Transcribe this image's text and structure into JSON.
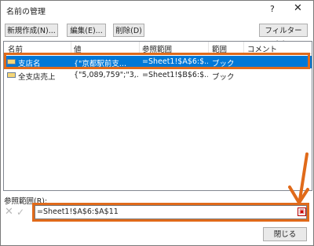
{
  "dialog": {
    "title": "名前の管理",
    "help_label": "?",
    "close_label": "✕"
  },
  "toolbar": {
    "new_label": "新規作成(N)...",
    "edit_label": "編集(E)...",
    "delete_label": "削除(D)",
    "filter_label": "フィルター(F) ▾"
  },
  "list": {
    "headers": [
      "名前",
      "値",
      "参照範囲",
      "範囲",
      "コメント"
    ],
    "rows": [
      {
        "name": "支店名",
        "value": "{\"京都駅前支...",
        "ref": "=Sheet1!$A$6:$...",
        "scope": "ブック",
        "comment": ""
      },
      {
        "name": "全支店売上",
        "value": "{\"5,089,759\";\"3,...",
        "ref": "=Sheet1!$B$6:$...",
        "scope": "ブック",
        "comment": ""
      }
    ]
  },
  "refers_to": {
    "label": "参照範囲(R):",
    "value": "=Sheet1!$A$6:$A$11",
    "cancel_glyph": "✕",
    "confirm_glyph": "✓"
  },
  "footer": {
    "close_label": "閉じる"
  },
  "colors": {
    "accent": "#e06a1a",
    "selection": "#0078d7"
  },
  "icons": {
    "name_icon": "named-range-icon",
    "collapse_icon": "collapse-dialog-icon",
    "arrow": "annotation-arrow"
  }
}
